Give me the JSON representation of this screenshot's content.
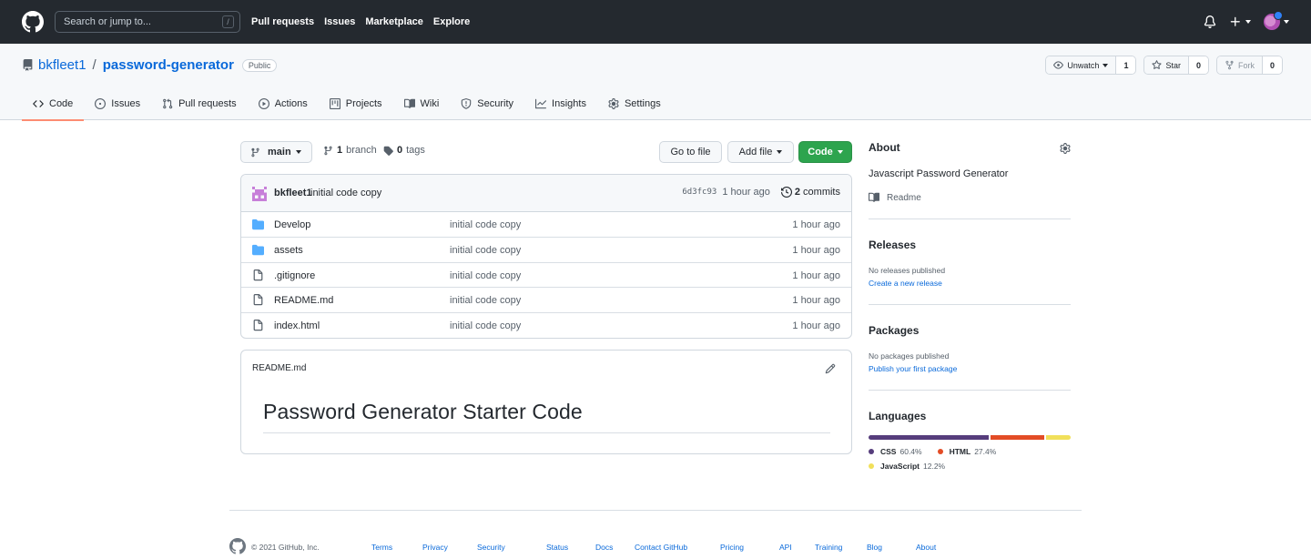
{
  "header": {
    "search_placeholder": "Search or jump to...",
    "search_shortcut": "/",
    "nav": [
      "Pull requests",
      "Issues",
      "Marketplace",
      "Explore"
    ]
  },
  "repo": {
    "owner": "bkfleet1",
    "separator": "/",
    "name": "password-generator",
    "visibility": "Public",
    "actions": {
      "watch": {
        "label": "Unwatch",
        "count": "1"
      },
      "star": {
        "label": "Star",
        "count": "0"
      },
      "fork": {
        "label": "Fork",
        "count": "0"
      }
    },
    "tabs": [
      "Code",
      "Issues",
      "Pull requests",
      "Actions",
      "Projects",
      "Wiki",
      "Security",
      "Insights",
      "Settings"
    ]
  },
  "toolbar": {
    "branch": "main",
    "branches_count": "1",
    "branches_label": "branch",
    "tags_count": "0",
    "tags_label": "tags",
    "go_to_file": "Go to file",
    "add_file": "Add file",
    "code": "Code"
  },
  "commit": {
    "author": "bkfleet1",
    "message": "initial code copy",
    "sha": "6d3fc93",
    "age": "1 hour ago",
    "commits_count": "2",
    "commits_label": "commits"
  },
  "files": [
    {
      "type": "dir",
      "name": "Develop",
      "message": "initial code copy",
      "age": "1 hour ago"
    },
    {
      "type": "dir",
      "name": "assets",
      "message": "initial code copy",
      "age": "1 hour ago"
    },
    {
      "type": "file",
      "name": ".gitignore",
      "message": "initial code copy",
      "age": "1 hour ago"
    },
    {
      "type": "file",
      "name": "README.md",
      "message": "initial code copy",
      "age": "1 hour ago"
    },
    {
      "type": "file",
      "name": "index.html",
      "message": "initial code copy",
      "age": "1 hour ago"
    }
  ],
  "readme": {
    "filename": "README.md",
    "heading": "Password Generator Starter Code"
  },
  "sidebar": {
    "about_title": "About",
    "description": "Javascript Password Generator",
    "readme_label": "Readme",
    "releases_title": "Releases",
    "releases_empty": "No releases published",
    "releases_link": "Create a new release",
    "packages_title": "Packages",
    "packages_empty": "No packages published",
    "packages_link": "Publish your first package",
    "languages_title": "Languages",
    "languages": [
      {
        "name": "CSS",
        "percent": "60.4%",
        "value": 60.4,
        "color": "#563d7c"
      },
      {
        "name": "HTML",
        "percent": "27.4%",
        "value": 27.4,
        "color": "#e34c26"
      },
      {
        "name": "JavaScript",
        "percent": "12.2%",
        "value": 12.2,
        "color": "#f1e05a"
      }
    ]
  },
  "footer": {
    "copyright": "© 2021 GitHub, Inc.",
    "links": [
      "Terms",
      "Privacy",
      "Security",
      "Status",
      "Docs",
      "Contact GitHub",
      "Pricing",
      "API",
      "Training",
      "Blog",
      "About"
    ]
  },
  "colors": {
    "header_bg": "#24292f",
    "link": "#0969da",
    "primary_button": "#2da44e",
    "active_tab_underline": "#fd8c73"
  }
}
